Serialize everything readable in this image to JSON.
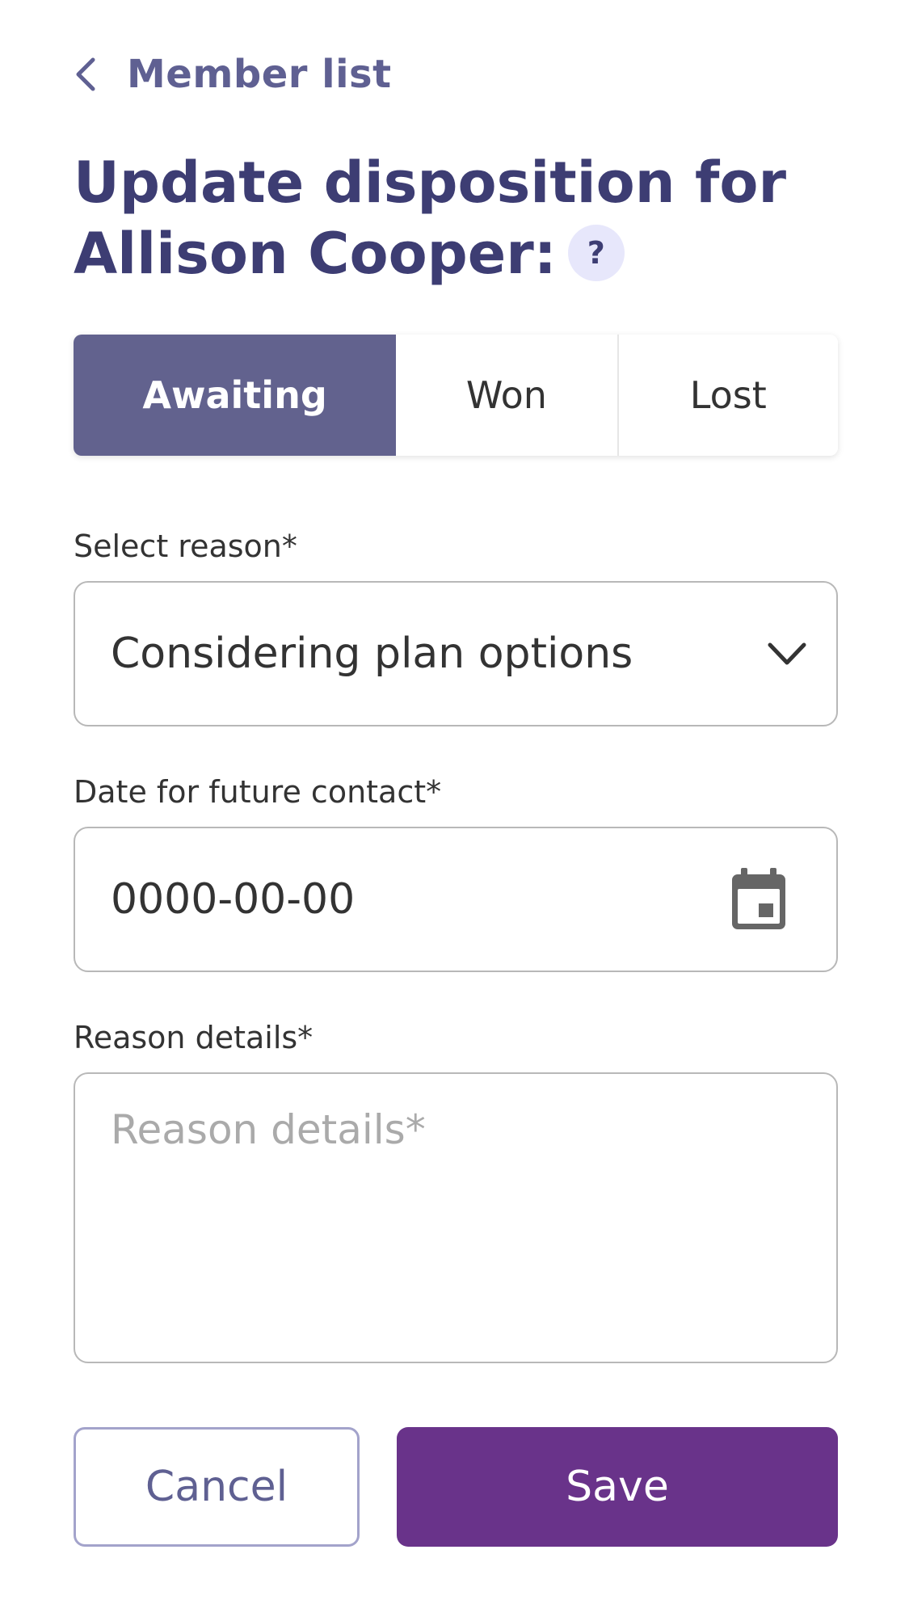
{
  "header": {
    "back_label": "Member list",
    "title_line1": "Update disposition for",
    "title_line2": "Allison Cooper:",
    "help_glyph": "?"
  },
  "tabs": [
    {
      "label": "Awaiting",
      "active": true
    },
    {
      "label": "Won",
      "active": false
    },
    {
      "label": "Lost",
      "active": false
    }
  ],
  "form": {
    "reason": {
      "label": "Select reason*",
      "value": "Considering plan options"
    },
    "date": {
      "label": "Date for future contact*",
      "value": "0000-00-00"
    },
    "details": {
      "label": "Reason details*",
      "placeholder": "Reason details*",
      "value": ""
    }
  },
  "actions": {
    "cancel_label": "Cancel",
    "save_label": "Save"
  },
  "icons": {
    "back": "chevron-left-icon",
    "help": "help-icon",
    "dropdown": "chevron-down-icon",
    "calendar": "calendar-icon"
  },
  "colors": {
    "primary_text": "#3d3d73",
    "link": "#5f6092",
    "active_tab": "#62628e",
    "save_button": "#69338a",
    "help_bg": "#e7e7fb"
  }
}
